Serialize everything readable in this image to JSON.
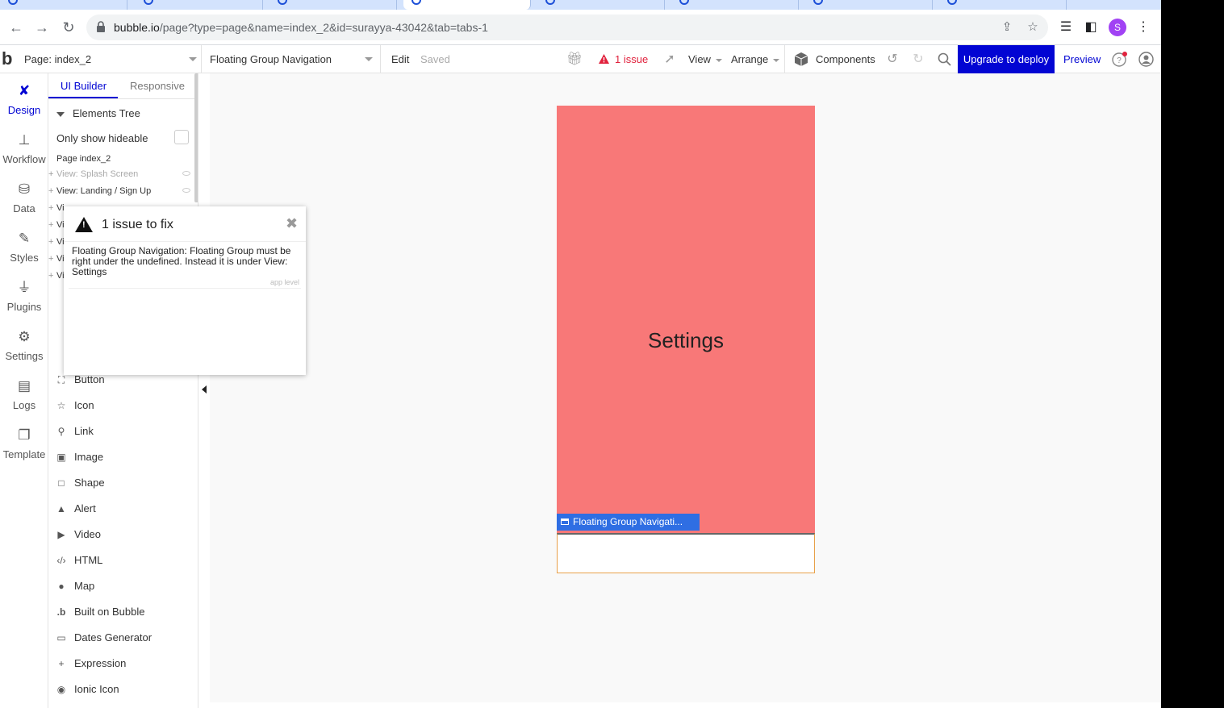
{
  "browser": {
    "url_host": "bubble.io",
    "url_path": "/page?type=page&name=index_2&id=surayya-43042&tab=tabs-1",
    "profile_initial": "S"
  },
  "topbar": {
    "logo": "b",
    "page_select": "Page: index_2",
    "element_select": "Floating Group Navigation",
    "edit": "Edit",
    "saved": "Saved",
    "issues": "1 issue",
    "view": "View",
    "arrange": "Arrange",
    "components": "Components",
    "upgrade": "Upgrade to deploy",
    "preview": "Preview"
  },
  "leftnav": [
    {
      "label": "Design",
      "icon": "design-icon"
    },
    {
      "label": "Workflow",
      "icon": "workflow-icon"
    },
    {
      "label": "Data",
      "icon": "data-icon"
    },
    {
      "label": "Styles",
      "icon": "brush-icon"
    },
    {
      "label": "Plugins",
      "icon": "plug-icon"
    },
    {
      "label": "Settings",
      "icon": "gear-icon"
    },
    {
      "label": "Logs",
      "icon": "document-icon"
    },
    {
      "label": "Template",
      "icon": "template-icon"
    }
  ],
  "panel": {
    "tab_builder": "UI Builder",
    "tab_responsive": "Responsive",
    "tree_header": "Elements Tree",
    "only_hideable": "Only show hideable",
    "page_row": "Page index_2",
    "tree_rows": [
      "View: Splash Screen",
      "View: Landing / Sign Up",
      "Vi",
      "Vi",
      "Vi",
      "Vi",
      "Vi"
    ],
    "elements": [
      {
        "label": "Button",
        "icon": "button-icon"
      },
      {
        "label": "Icon",
        "icon": "star-icon"
      },
      {
        "label": "Link",
        "icon": "link-icon"
      },
      {
        "label": "Image",
        "icon": "image-icon"
      },
      {
        "label": "Shape",
        "icon": "shape-icon"
      },
      {
        "label": "Alert",
        "icon": "alert-icon"
      },
      {
        "label": "Video",
        "icon": "video-icon"
      },
      {
        "label": "HTML",
        "icon": "code-icon"
      },
      {
        "label": "Map",
        "icon": "map-pin-icon"
      },
      {
        "label": "Built on Bubble",
        "icon": "bubble-logo-icon"
      },
      {
        "label": "Dates Generator",
        "icon": "calendar-icon"
      },
      {
        "label": "Expression",
        "icon": "plus-icon"
      },
      {
        "label": "Ionic Icon",
        "icon": "ionic-icon"
      }
    ]
  },
  "canvas": {
    "settings_title": "Settings",
    "floating_tag": "Floating Group Navigati..."
  },
  "issue_popup": {
    "title": "1 issue to fix",
    "message": "Floating Group Navigation: Floating Group must be right under the undefined. Instead it is under View: Settings",
    "level": "app level"
  },
  "colors": {
    "accent": "#0205d3",
    "settings_bg": "#f87878",
    "issue_red": "#e1223d",
    "tag_blue": "#2f6ee3"
  }
}
